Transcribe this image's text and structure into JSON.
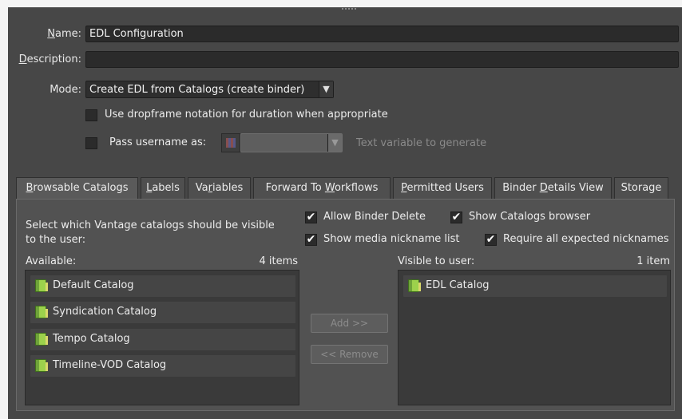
{
  "form": {
    "name_label_u": "N",
    "name_label_rest": "ame:",
    "name_value": "EDL Configuration",
    "description_label_u": "D",
    "description_label_rest": "escription:",
    "description_value": "",
    "mode_label": "Mode:",
    "mode_value": "Create EDL from Catalogs (create binder)",
    "dropframe_label": "Use dropframe notation for duration when appropriate",
    "dropframe_checked": false,
    "pass_username_label": "Pass username as:",
    "pass_username_checked": false,
    "pass_username_value": "",
    "text_variable_placeholder": "Text variable to generate"
  },
  "tabs": [
    {
      "pre": "",
      "u": "B",
      "post": "rowsable Catalogs",
      "active": true
    },
    {
      "pre": "",
      "u": "L",
      "post": "abels",
      "active": false
    },
    {
      "pre": "Va",
      "u": "r",
      "post": "iables",
      "active": false
    },
    {
      "pre": "Forward To ",
      "u": "W",
      "post": "orkflows",
      "active": false
    },
    {
      "pre": "",
      "u": "P",
      "post": "ermitted Users",
      "active": false
    },
    {
      "pre": "Binder ",
      "u": "D",
      "post": "etails View",
      "active": false
    },
    {
      "pre": "Storage",
      "u": "",
      "post": "",
      "active": false
    }
  ],
  "catalogs_tab": {
    "description_line1": "Select which Vantage catalogs should be visible",
    "description_line2": "to the user:",
    "allow_binder_delete": "Allow Binder Delete",
    "allow_binder_delete_checked": true,
    "show_catalogs_browser": "Show Catalogs browser",
    "show_catalogs_browser_checked": true,
    "show_media_nickname_list": "Show media nickname list",
    "show_media_nickname_list_checked": true,
    "require_all_expected_nicknames": "Require all expected nicknames",
    "require_all_expected_nicknames_checked": true,
    "available_label": "Available:",
    "available_count": "4 items",
    "available_items": [
      "Default Catalog",
      "Syndication Catalog",
      "Tempo Catalog",
      "Timeline-VOD Catalog"
    ],
    "visible_label": "Visible to user:",
    "visible_count": "1 item",
    "visible_items": [
      "EDL Catalog"
    ],
    "add_button": "Add >>",
    "remove_button": "<< Remove"
  },
  "icons": {
    "catalog": "catalog-icon",
    "check": "✔",
    "dropdown": "chevron-down-icon",
    "variable": "variable-icon"
  }
}
